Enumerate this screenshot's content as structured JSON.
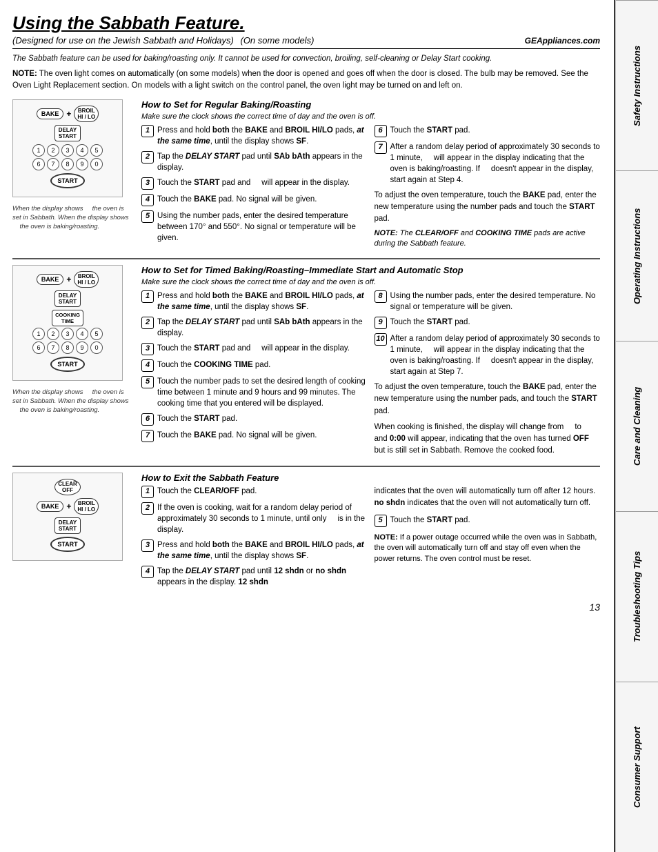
{
  "page": {
    "title": "Using the Sabbath Feature.",
    "subtitle": "(Designed for use on the Jewish Sabbath and Holidays)",
    "subtitle2": "(On some models)",
    "website": "GEAppliances.com",
    "intro": "The Sabbath feature can be used for baking/roasting only. It cannot be used for convection, broiling, self-cleaning or Delay Start cooking.",
    "note": "NOTE: The oven light comes on automatically (on some models) when the door is opened and goes off when the door is closed. The bulb may be removed. See the Oven Light Replacement section. On models with a light switch on the control panel, the oven light may be turned on and left on.",
    "page_number": "13"
  },
  "section1": {
    "title": "How to Set for Regular Baking/Roasting",
    "make_sure": "Make sure the clock shows the correct time of day and the oven is off.",
    "steps_left": [
      {
        "num": "1",
        "text": "Press and hold both the BAKE and BROIL HI/LO pads, at the same time, until the display shows SF."
      },
      {
        "num": "2",
        "text": "Tap the DELAY START pad until SAb bAth appears in the display."
      },
      {
        "num": "3",
        "text": "Touch the START pad and     will appear in the display."
      },
      {
        "num": "4",
        "text": "Touch the BAKE pad. No signal will be given."
      },
      {
        "num": "5",
        "text": "Using the number pads, enter the desired temperature between 170° and 550°. No signal or temperature will be given."
      }
    ],
    "steps_right": [
      {
        "num": "6",
        "text": "Touch the START pad."
      },
      {
        "num": "7",
        "text": "After a random delay period of approximately 30 seconds to 1 minute,      will appear in the display indicating that the oven is baking/roasting. If      doesn't appear in the display, start again at Step 4."
      }
    ],
    "adjust_text": "To adjust the oven temperature, touch the BAKE pad, enter the new temperature using the number pads and touch the START pad.",
    "note_text": "NOTE: The CLEAR/OFF and COOKING TIME pads are active during the Sabbath feature.",
    "diagram_caption": "When the display shows     the oven is set in Sabbath. When the display shows     the oven is baking/roasting."
  },
  "section2": {
    "title": "How to Set for Timed Baking/Roasting–Immediate Start and Automatic Stop",
    "make_sure": "Make sure the clock shows the correct time of day and the oven is off.",
    "steps_left": [
      {
        "num": "1",
        "text": "Press and hold both the BAKE and BROIL HI/LO pads, at the same time, until the display shows SF."
      },
      {
        "num": "2",
        "text": "Tap the DELAY START pad until SAb bAth appears in the display."
      },
      {
        "num": "3",
        "text": "Touch the START pad and     will appear in the display."
      },
      {
        "num": "4",
        "text": "Touch the COOKING TIME pad."
      },
      {
        "num": "5",
        "text": "Touch the number pads to set the desired length of cooking time between 1 minute and 9 hours and 99 minutes. The cooking time that you entered will be displayed."
      },
      {
        "num": "6",
        "text": "Touch the START pad."
      },
      {
        "num": "7",
        "text": "Touch the BAKE pad. No signal will be given."
      }
    ],
    "steps_right": [
      {
        "num": "8",
        "text": "Using the number pads, enter the desired temperature. No signal or temperature will be given."
      },
      {
        "num": "9",
        "text": "Touch the START pad."
      },
      {
        "num": "10",
        "text": "After a random delay period of approximately 30 seconds to 1 minute,      will appear in the display indicating that the oven is baking/roasting. If      doesn't appear in the display, start again at Step 7."
      }
    ],
    "adjust_text": "To adjust the oven temperature, touch the BAKE pad, enter the new temperature using the number pads, and touch the START pad.",
    "finish_text": "When cooking is finished, the display will change from      to     and 0:00 will appear, indicating that the oven has turned OFF but is still set in Sabbath. Remove the cooked food.",
    "diagram_caption": "When the display shows     the oven is set in Sabbath. When the display shows     the oven is baking/roasting."
  },
  "section3": {
    "title": "How to Exit the Sabbath Feature",
    "steps_left": [
      {
        "num": "1",
        "text": "Touch the CLEAR/OFF pad."
      },
      {
        "num": "2",
        "text": "If the oven is cooking, wait for a random delay period of approximately 30 seconds to 1 minute, until only      is in the display."
      },
      {
        "num": "3",
        "text": "Press and hold both the BAKE and BROIL HI/LO pads, at the same time, until the display shows SF."
      },
      {
        "num": "4",
        "text": "Tap the DELAY START pad until 12 shdn or no shdn appears in the display. 12 shdn"
      }
    ],
    "steps_right": [
      {
        "text": "indicates that the oven will automatically turn off after 12 hours. no shdn indicates that the oven will not automatically turn off."
      },
      {
        "num": "5",
        "text": "Touch the START pad."
      }
    ],
    "note_power": "NOTE: If a power outage occurred while the oven was in Sabbath, the oven will automatically turn off and stay off even when the power returns. The oven control must be reset."
  },
  "sidebar": {
    "sections": [
      "Safety Instructions",
      "Operating Instructions",
      "Care and Cleaning",
      "Troubleshooting Tips",
      "Consumer Support"
    ]
  }
}
